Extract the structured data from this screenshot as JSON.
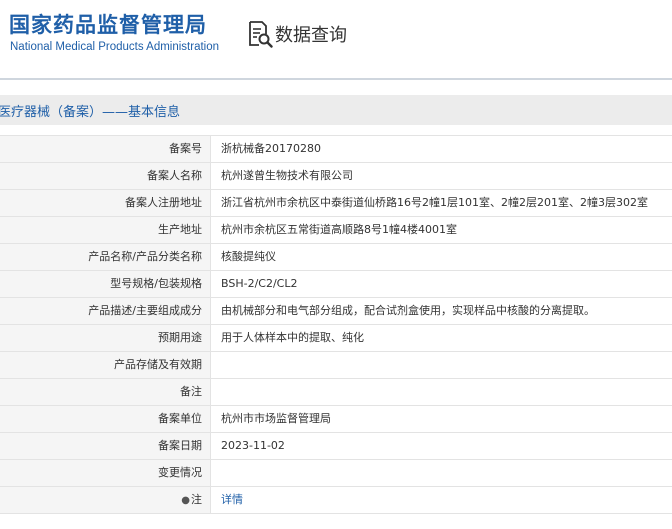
{
  "header": {
    "logo_cn": "国家药品监督管理局",
    "logo_en": "National Medical Products Administration",
    "query_label": "数据查询"
  },
  "section": {
    "title": "医疗器械（备案）——基本信息"
  },
  "rows": [
    {
      "label": "备案号",
      "value": "浙杭械备20170280"
    },
    {
      "label": "备案人名称",
      "value": "杭州遂曾生物技术有限公司"
    },
    {
      "label": "备案人注册地址",
      "value": "浙江省杭州市余杭区中泰街道仙桥路16号2幢1层101室、2幢2层201室、2幢3层302室"
    },
    {
      "label": "生产地址",
      "value": "杭州市余杭区五常街道高顺路8号1幢4楼4001室"
    },
    {
      "label": "产品名称/产品分类名称",
      "value": "核酸提纯仪"
    },
    {
      "label": "型号规格/包装规格",
      "value": "BSH-2/C2/CL2"
    },
    {
      "label": "产品描述/主要组成成分",
      "value": "由机械部分和电气部分组成，配合试剂盒使用，实现样品中核酸的分离提取。"
    },
    {
      "label": "预期用途",
      "value": "用于人体样本中的提取、纯化"
    },
    {
      "label": "产品存储及有效期",
      "value": ""
    },
    {
      "label": "备注",
      "value": ""
    },
    {
      "label": "备案单位",
      "value": "杭州市市场监督管理局"
    },
    {
      "label": "备案日期",
      "value": "2023-11-02"
    },
    {
      "label": "变更情况",
      "value": ""
    }
  ],
  "note_row": {
    "pin_icon": "pin-icon",
    "label": "注",
    "link_text": "详情"
  }
}
